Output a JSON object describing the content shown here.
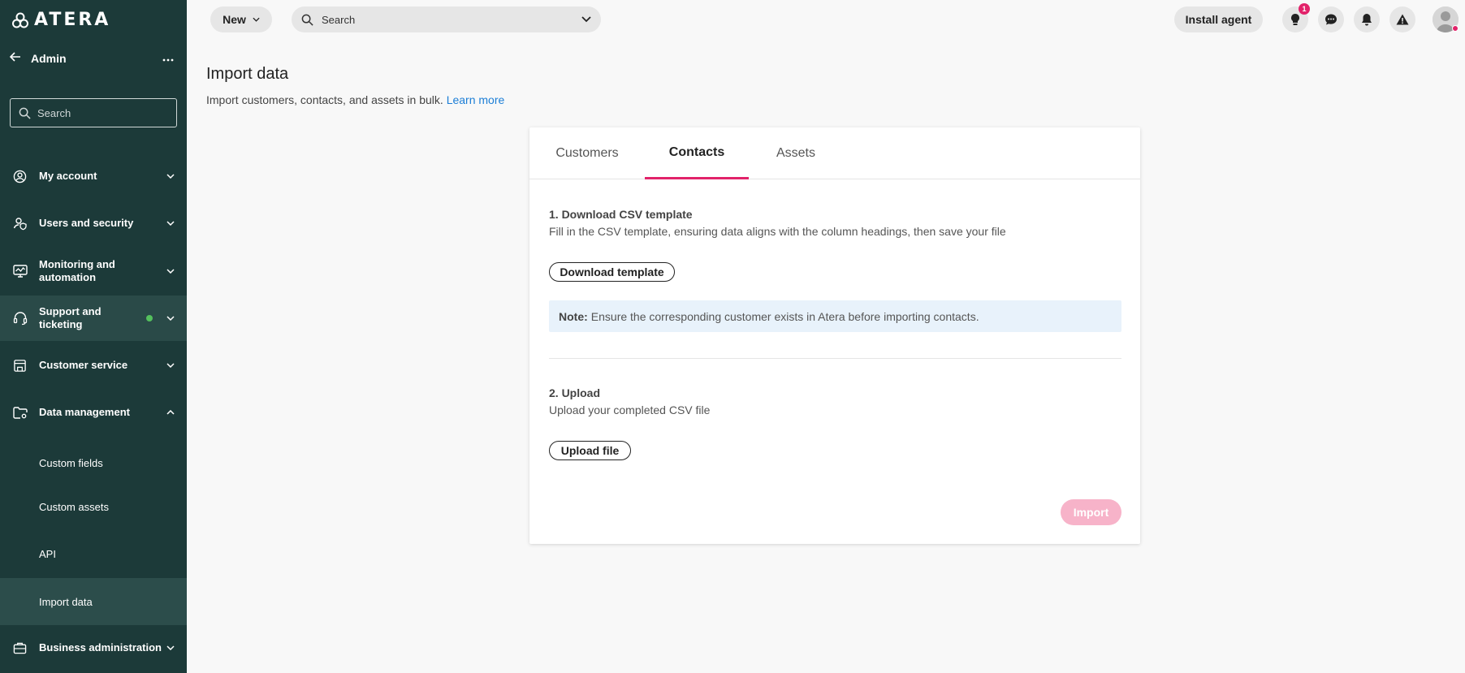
{
  "app": {
    "logo_text": "ATERA"
  },
  "sidebar": {
    "title": "Admin",
    "search_placeholder": "Search",
    "items": [
      {
        "label": "My account"
      },
      {
        "label": "Users and security"
      },
      {
        "label": "Monitoring and automation"
      },
      {
        "label": "Support and ticketing"
      },
      {
        "label": "Customer service"
      },
      {
        "label": "Data management"
      },
      {
        "label": "Business administration"
      }
    ],
    "sub_items": [
      {
        "label": "Custom fields"
      },
      {
        "label": "Custom assets"
      },
      {
        "label": "API"
      },
      {
        "label": "Import data"
      }
    ]
  },
  "topbar": {
    "new_label": "New",
    "search_placeholder": "Search",
    "install_label": "Install agent",
    "tips_badge": "1"
  },
  "page": {
    "title": "Import data",
    "subtitle": "Import customers, contacts, and assets in bulk.",
    "learn_more": "Learn more"
  },
  "tabs": [
    {
      "label": "Customers"
    },
    {
      "label": "Contacts"
    },
    {
      "label": "Assets"
    }
  ],
  "step1": {
    "title": "1. Download CSV template",
    "desc": "Fill in the CSV template, ensuring data aligns with the column headings, then save your file",
    "button": "Download template"
  },
  "note": {
    "label": "Note:",
    "text": "Ensure the corresponding customer exists in Atera before importing contacts."
  },
  "step2": {
    "title": "2. Upload",
    "desc": "Upload your completed CSV file",
    "button": "Upload file"
  },
  "import_label": "Import",
  "colors": {
    "sidebar_bg": "#1c3a39",
    "accent": "#e2236a",
    "link": "#1c7ed6",
    "status_dot": "#54c05d"
  }
}
